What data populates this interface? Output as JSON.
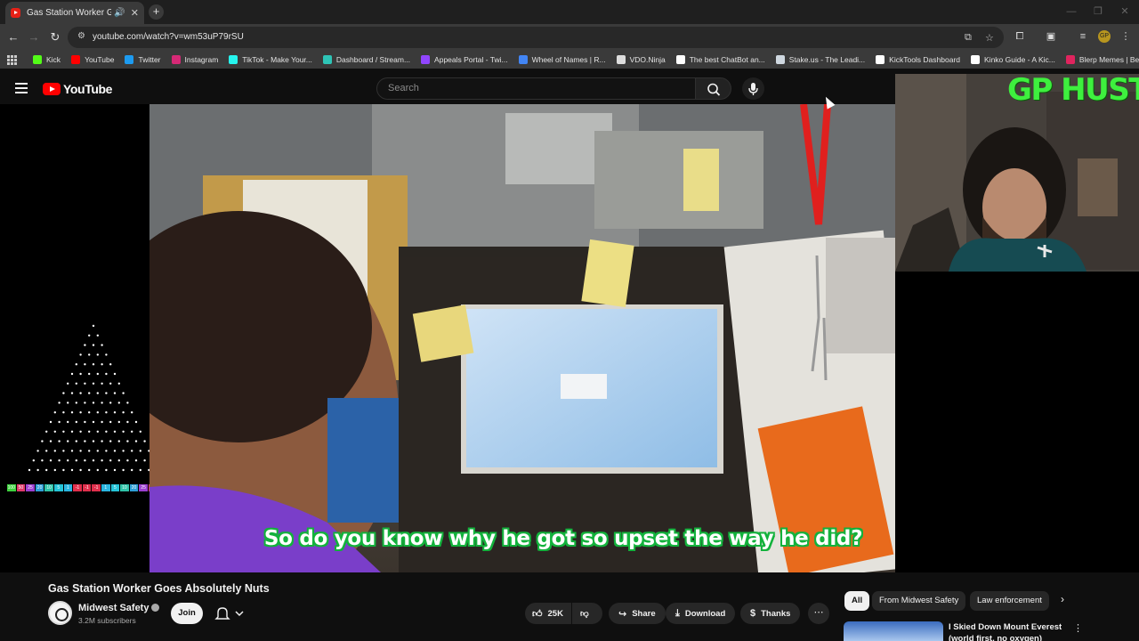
{
  "browser": {
    "tab_title": "Gas Station Worker Goes Ab",
    "url": "youtube.com/watch?v=wm53uP79rSU",
    "bookmarks": [
      {
        "label": "Kick",
        "color": "#53fc18"
      },
      {
        "label": "YouTube",
        "color": "#ff0000"
      },
      {
        "label": "Twitter",
        "color": "#1d9bf0"
      },
      {
        "label": "Instagram",
        "color": "#d62976"
      },
      {
        "label": "TikTok - Make Your...",
        "color": "#25f4ee"
      },
      {
        "label": "Dashboard / Stream...",
        "color": "#2ec4b6"
      },
      {
        "label": "Appeals Portal - Twi...",
        "color": "#9146ff"
      },
      {
        "label": "Wheel of Names | R...",
        "color": "#4285f4"
      },
      {
        "label": "VDO.Ninja",
        "color": "#dddddd"
      },
      {
        "label": "The best ChatBot an...",
        "color": "#ffffff"
      },
      {
        "label": "Stake.us - The Leadi...",
        "color": "#cfd8e0"
      },
      {
        "label": "KickTools Dashboard",
        "color": "#ffffff"
      },
      {
        "label": "Kinko Guide - A Kic...",
        "color": "#ffffff"
      },
      {
        "label": "Blerp Memes | Best...",
        "color": "#e0245e"
      }
    ]
  },
  "youtube": {
    "logo_text": "YouTube",
    "search_placeholder": "Search"
  },
  "overlay": {
    "caption": "So do you know why he got so upset the way he did?",
    "webcam_banner": "GP HUSTLA",
    "eq_labels": [
      "100",
      "50",
      "25",
      "20",
      "10",
      "5",
      "1",
      "-1",
      "-1",
      "-1",
      "1",
      "5",
      "10",
      "20",
      "25",
      "50",
      "100"
    ]
  },
  "video": {
    "title": "Gas Station Worker Goes Absolutely Nuts",
    "channel_name": "Midwest Safety",
    "subscribers": "3.2M subscribers",
    "join_label": "Join",
    "likes": "25K",
    "share_label": "Share",
    "download_label": "Download",
    "thanks_label": "Thanks"
  },
  "sidebar": {
    "chips": [
      "All",
      "From Midwest Safety",
      "Law enforcement"
    ],
    "rec_title": "I Skied Down Mount Everest (world first, no oxygen)"
  },
  "colors": {
    "caption_outline": "#13b23c",
    "youtube_red": "#ff0000",
    "banner_green": "#3ef03e"
  }
}
